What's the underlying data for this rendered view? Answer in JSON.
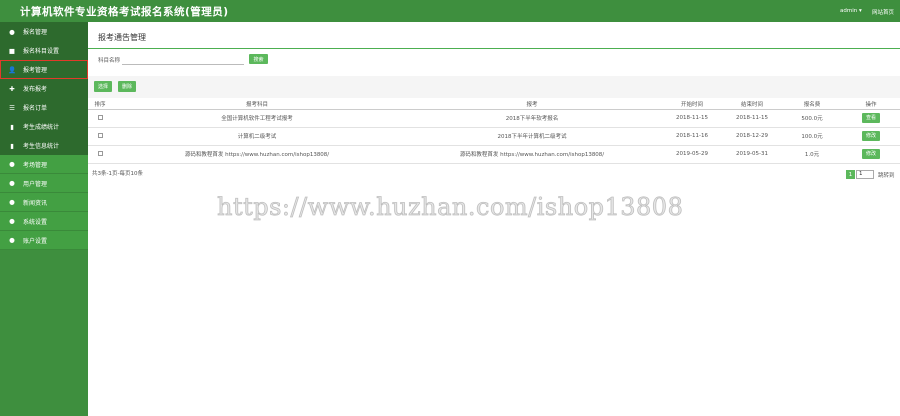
{
  "header": {
    "title": "计算机软件专业资格考试报名系统(管理员)",
    "user": "admin ▾",
    "site_link": "网站首页"
  },
  "sidebar": {
    "items": [
      {
        "label": "报名管理",
        "icon": "circle-icon",
        "glyph": "●",
        "style": "dark"
      },
      {
        "label": "报名科目设置",
        "icon": "square-icon",
        "glyph": "■",
        "style": "dark"
      },
      {
        "label": "报考管理",
        "icon": "user-icon",
        "glyph": "👤",
        "style": "dark",
        "active": true
      },
      {
        "label": "发布报考",
        "icon": "plus-icon",
        "glyph": "✚",
        "style": "dark"
      },
      {
        "label": "报名订单",
        "icon": "list-icon",
        "glyph": "☰",
        "style": "dark"
      },
      {
        "label": "考生成绩统计",
        "icon": "bar-chart-icon",
        "glyph": "▮",
        "style": "dark"
      },
      {
        "label": "考生信息统计",
        "icon": "bar-chart-icon",
        "glyph": "▮",
        "style": "dark"
      },
      {
        "label": "考场管理",
        "icon": "circle-icon",
        "glyph": "●",
        "style": "green"
      },
      {
        "label": "用户管理",
        "icon": "circle-icon",
        "glyph": "●",
        "style": "green"
      },
      {
        "label": "新闻资讯",
        "icon": "circle-icon",
        "glyph": "●",
        "style": "green"
      },
      {
        "label": "系统设置",
        "icon": "circle-icon",
        "glyph": "●",
        "style": "green"
      },
      {
        "label": "账户设置",
        "icon": "circle-icon",
        "glyph": "●",
        "style": "green"
      }
    ]
  },
  "main": {
    "page_title": "报考通告管理",
    "search": {
      "label": "科目名称",
      "value": "",
      "placeholder": "",
      "button": "搜索"
    },
    "toolbar": {
      "select_all": "选择",
      "delete": "删除"
    },
    "table": {
      "headers": [
        "排序",
        "报考科目",
        "报考",
        "开始时间",
        "结束时间",
        "报名费",
        "操作"
      ],
      "rows": [
        {
          "subject": "全国计算机软件工程考试报考",
          "exam": "2018下半年软考报名",
          "start": "2018-11-15",
          "end": "2018-11-15",
          "fee": "500.0元",
          "action": "查看"
        },
        {
          "subject": "计算机二级考试",
          "exam": "2018下半年计算机二级考试",
          "start": "2018-11-16",
          "end": "2018-12-29",
          "fee": "100.0元",
          "action": "修改"
        },
        {
          "subject": "源码和教程首发 https://www.huzhan.com/ishop13808/",
          "exam": "源码和教程首发 https://www.huzhan.com/ishop13808/",
          "start": "2019-05-29",
          "end": "2019-05-31",
          "fee": "1.0元",
          "action": "修改"
        }
      ]
    },
    "pager": {
      "summary": "共3条-1页-每页10条",
      "current": "1",
      "input_value": "1",
      "goto": "跳转到"
    }
  },
  "watermark": "https://www.huzhan.com/ishop13808",
  "colors": {
    "header": "#3e8f3e",
    "sidebar_dark": "#2d6a2d",
    "sidebar_green": "#43a043",
    "button": "#5cb85c",
    "active_outline": "#e23a2a"
  }
}
